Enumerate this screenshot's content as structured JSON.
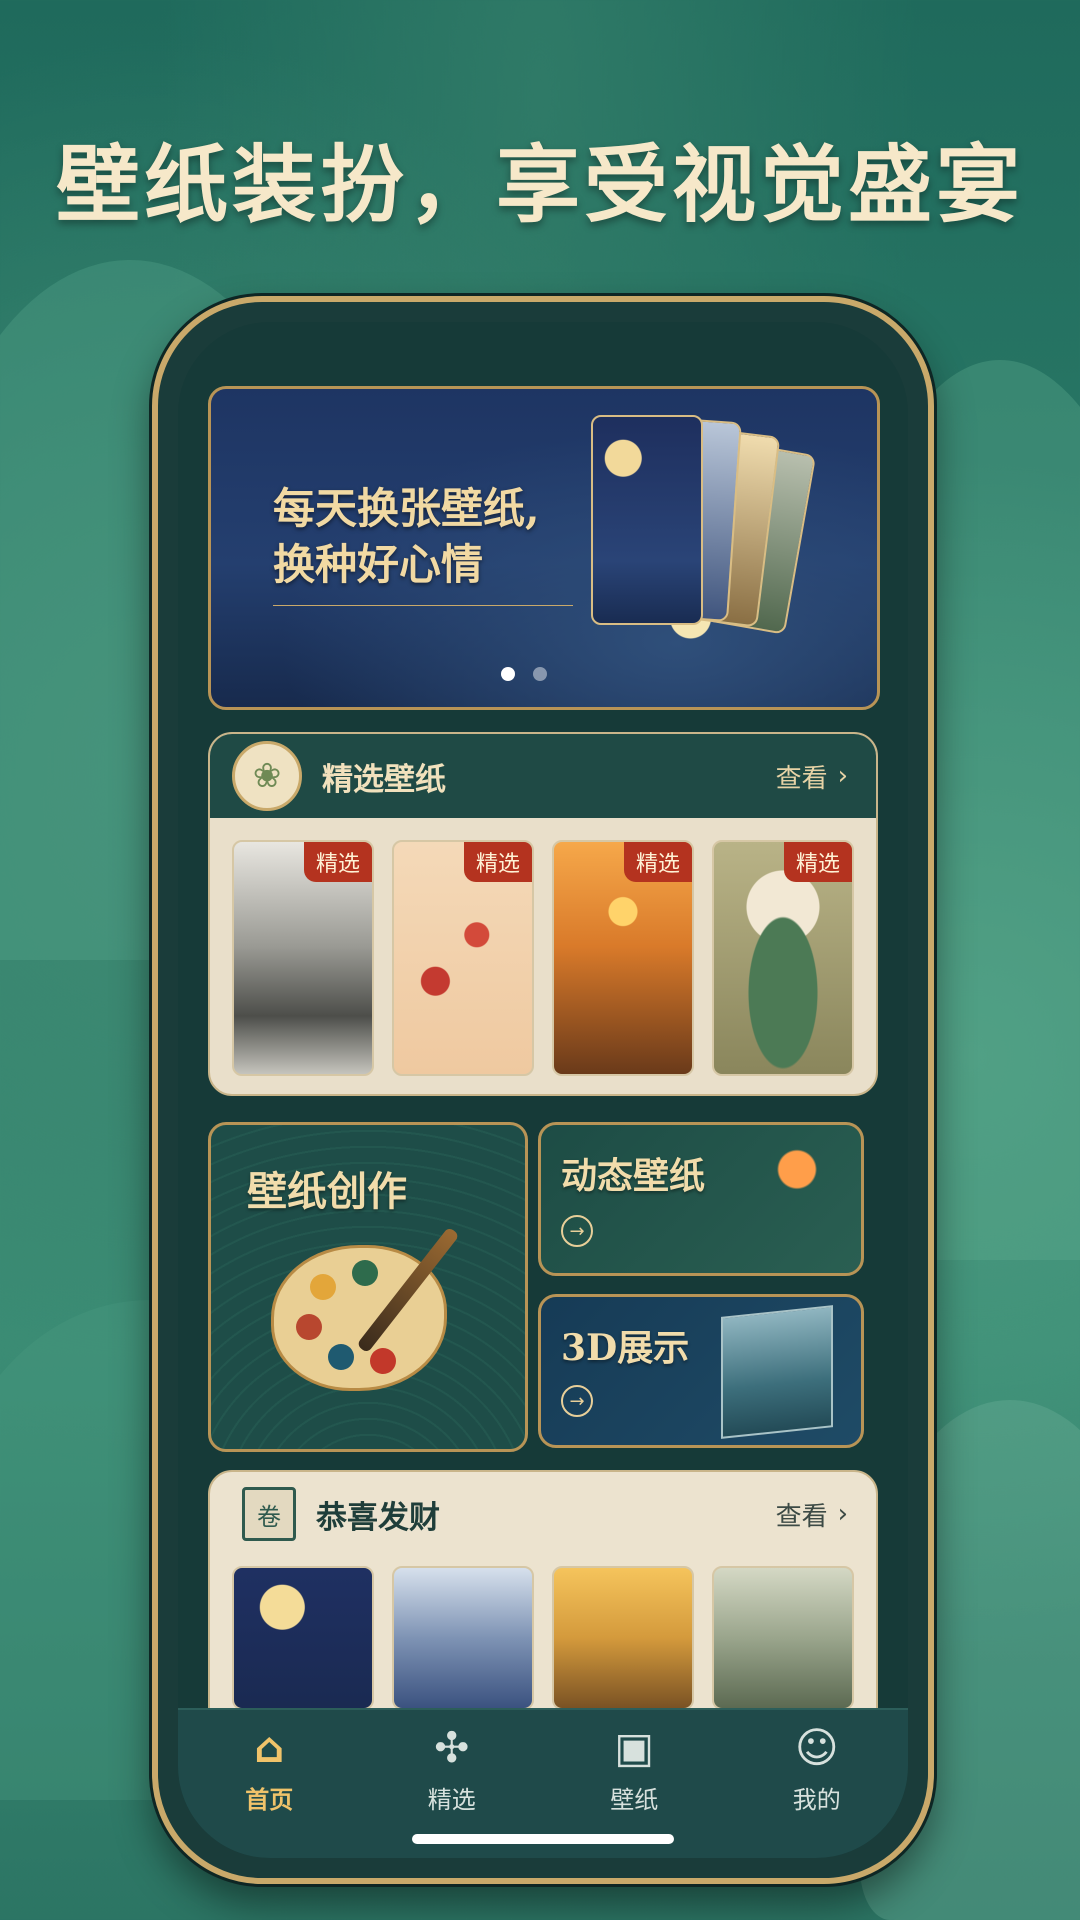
{
  "headline": "壁纸装扮，享受视觉盛宴",
  "banner": {
    "line1": "每天换张壁纸,",
    "line2": "换种好心情",
    "page_count": 2,
    "active_page": 1
  },
  "featured": {
    "title": "精选壁纸",
    "more_label": "查看",
    "icon": "lotus-icon",
    "items": [
      {
        "tag": "精选",
        "subject": "ink landscape"
      },
      {
        "tag": "精选",
        "subject": "plum blossom bird"
      },
      {
        "tag": "精选",
        "subject": "sunset boat"
      },
      {
        "tag": "精选",
        "subject": "peony vase"
      }
    ]
  },
  "tiles": {
    "create": "壁纸创作",
    "live": "动态壁纸",
    "display3d": "3D展示"
  },
  "fortune": {
    "title": "恭喜发财",
    "more_label": "查看",
    "icon": "scroll-icon"
  },
  "tabbar": [
    {
      "label": "首页",
      "icon": "home-icon",
      "active": true
    },
    {
      "label": "精选",
      "icon": "grid-icon",
      "active": false
    },
    {
      "label": "壁纸",
      "icon": "image-icon",
      "active": false
    },
    {
      "label": "我的",
      "icon": "user-icon",
      "active": false
    }
  ],
  "colors": {
    "accent": "#f0c36a",
    "tag": "#b4331f",
    "frame": "#c9a96a"
  }
}
